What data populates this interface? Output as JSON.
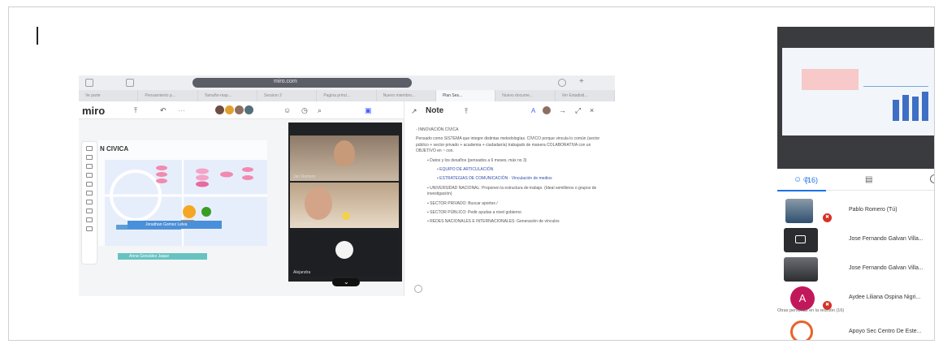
{
  "browser": {
    "address": "miro.com",
    "tabs": [
      "Ve parte",
      "Pensamiento p...",
      "Tamaño-map...",
      "Session 2",
      "Pagina princi...",
      "Nuevo miembro...",
      "Plan Ses...",
      "Nuevo docume...",
      "Ver Estadisti..."
    ]
  },
  "miro": {
    "logo": "miro",
    "board_title": "N CIVICA",
    "cards": [
      "Jonathan Gomez Leiva",
      "Anna González Jaque"
    ],
    "video_labels": [
      "Jan Romero",
      "Jose Jimen...",
      "Alejandra"
    ]
  },
  "note": {
    "title": "Note",
    "paragraphs": [
      {
        "cls": "",
        "text": "- INNOVACIÓN CÍVICA"
      },
      {
        "cls": "",
        "text": "Pensado como SISTEMA que integre distintas metodologías. CÍVICO porque vincula lo común (sector público + sector privado + academia + ciudadanía) trabajado de manera COLABORATIVA con un OBJETIVO en ~ con."
      },
      {
        "cls": "ind1 bul",
        "text": "Datos y los desafíos (pensados a 6 meses, máx no 3)"
      },
      {
        "cls": "ind2 bul",
        "text": "EQUIPO DE ARTICULACIÓN"
      },
      {
        "cls": "ind2 bul",
        "text": "ESTRATEGIAS DE COMUNICACIÓN · Vinculación de medios"
      },
      {
        "cls": "ind1 bul",
        "text": "UNIVERSIDAD NACIONAL: Proponen la estructura de trabajo. (Ideal semilleros o grupos de investigación)"
      },
      {
        "cls": "ind1 bul",
        "text": "SECTOR PRIVADO: Buscar aportes /"
      },
      {
        "cls": "ind1 bul",
        "text": "SECTOR PÚBLICO: Pedir ayudas a nivel gobierno"
      },
      {
        "cls": "ind1 bul",
        "text": "REDES NACIONALES E INTERNACIONALES: Generación de vínculos"
      }
    ]
  },
  "meeting": {
    "participant_count": "(16)",
    "participants": [
      {
        "name": "Pablo Romero (Tú)",
        "avatar": "photo"
      },
      {
        "name": "Jose Fernando Galvan Villa...",
        "avatar": "screen"
      },
      {
        "name": "Jose Fernando Galvan Villa...",
        "avatar": "photo"
      },
      {
        "name": "Aydee Liliana Ospina Nigri...",
        "avatar": "A"
      },
      {
        "name": "Apoyo Sec Centro De Este...",
        "avatar": "logo"
      }
    ],
    "more_label": "Otras personas en la reunión (16)"
  },
  "colors": {
    "accent": "#1a73e8",
    "miro_yellow": "#ffd02f",
    "avatar_A": "#c2185b",
    "mute_badge": "#d93025"
  },
  "icons": [
    "people-icon",
    "chat-icon",
    "info-icon",
    "present-icon",
    "mic-off-icon"
  ]
}
